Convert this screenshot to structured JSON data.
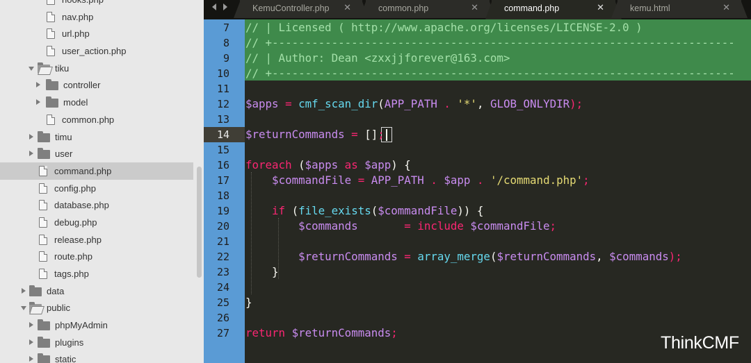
{
  "sidebar": {
    "items": [
      {
        "type": "file",
        "label": "hooks.php",
        "indent": 2
      },
      {
        "type": "file",
        "label": "nav.php",
        "indent": 2
      },
      {
        "type": "file",
        "label": "url.php",
        "indent": 2
      },
      {
        "type": "file",
        "label": "user_action.php",
        "indent": 2
      },
      {
        "type": "folder",
        "label": "tiku",
        "indent": 1,
        "open": true
      },
      {
        "type": "folder",
        "label": "controller",
        "indent": 2,
        "open": false
      },
      {
        "type": "folder",
        "label": "model",
        "indent": 2,
        "open": false
      },
      {
        "type": "file",
        "label": "common.php",
        "indent": 2
      },
      {
        "type": "folder",
        "label": "timu",
        "indent": 1,
        "open": false
      },
      {
        "type": "folder",
        "label": "user",
        "indent": 1,
        "open": false
      },
      {
        "type": "file",
        "label": "command.php",
        "indent": 1,
        "selected": true
      },
      {
        "type": "file",
        "label": "config.php",
        "indent": 1
      },
      {
        "type": "file",
        "label": "database.php",
        "indent": 1
      },
      {
        "type": "file",
        "label": "debug.php",
        "indent": 1
      },
      {
        "type": "file",
        "label": "release.php",
        "indent": 1
      },
      {
        "type": "file",
        "label": "route.php",
        "indent": 1
      },
      {
        "type": "file",
        "label": "tags.php",
        "indent": 1
      },
      {
        "type": "folder",
        "label": "data",
        "indent": 0,
        "open": false
      },
      {
        "type": "folder",
        "label": "public",
        "indent": 0,
        "open": true
      },
      {
        "type": "folder",
        "label": "phpMyAdmin",
        "indent": 1,
        "open": false
      },
      {
        "type": "folder",
        "label": "plugins",
        "indent": 1,
        "open": false
      },
      {
        "type": "folder",
        "label": "static",
        "indent": 1,
        "open": false
      }
    ]
  },
  "tabs": [
    {
      "label": "KemuController.php",
      "active": false
    },
    {
      "label": "common.php",
      "active": false
    },
    {
      "label": "command.php",
      "active": true
    },
    {
      "label": "kemu.html",
      "active": false
    }
  ],
  "tab_close_glyph": "✕",
  "editor": {
    "current_line": 14,
    "lines": [
      {
        "n": "7",
        "tokens": [
          {
            "t": "// | Licensed ( http://www.apache.org/licenses/LICENSE-2.0 )",
            "c": "cm"
          }
        ]
      },
      {
        "n": "8",
        "tokens": [
          {
            "t": "// +----------------------------------------------------------------------",
            "c": "cm"
          }
        ]
      },
      {
        "n": "9",
        "tokens": [
          {
            "t": "// | Author: Dean <zxxjjforever@163.com>",
            "c": "cm"
          }
        ]
      },
      {
        "n": "10",
        "tokens": [
          {
            "t": "// +----------------------------------------------------------------------",
            "c": "cm"
          }
        ]
      },
      {
        "n": "11",
        "tokens": []
      },
      {
        "n": "12",
        "tokens": [
          {
            "t": "$",
            "c": "pu"
          },
          {
            "t": "apps",
            "c": "var"
          },
          {
            "t": " = ",
            "c": "op"
          },
          {
            "t": "cmf_scan_dir",
            "c": "fn"
          },
          {
            "t": "(",
            "c": "pl"
          },
          {
            "t": "APP_PATH",
            "c": "co"
          },
          {
            "t": " . ",
            "c": "op"
          },
          {
            "t": "'*'",
            "c": "st"
          },
          {
            "t": ", ",
            "c": "pl"
          },
          {
            "t": "GLOB_ONLYDIR",
            "c": "co"
          },
          {
            "t": ");",
            "c": "op"
          }
        ]
      },
      {
        "n": "13",
        "tokens": []
      },
      {
        "n": "14",
        "tokens": [
          {
            "t": "$",
            "c": "pu"
          },
          {
            "t": "returnCommands",
            "c": "var"
          },
          {
            "t": " = ",
            "c": "op"
          },
          {
            "t": "[]",
            "c": "pl"
          },
          {
            "t": ";",
            "c": "op"
          }
        ]
      },
      {
        "n": "15",
        "tokens": []
      },
      {
        "n": "16",
        "tokens": [
          {
            "t": "foreach",
            "c": "kw"
          },
          {
            "t": " (",
            "c": "pl"
          },
          {
            "t": "$",
            "c": "pu"
          },
          {
            "t": "apps",
            "c": "var"
          },
          {
            "t": " as ",
            "c": "kw"
          },
          {
            "t": "$",
            "c": "pu"
          },
          {
            "t": "app",
            "c": "var"
          },
          {
            "t": ") {",
            "c": "pl"
          }
        ]
      },
      {
        "n": "17",
        "tokens": [
          {
            "t": "    ",
            "c": "pl"
          },
          {
            "t": "$",
            "c": "pu"
          },
          {
            "t": "commandFile",
            "c": "var"
          },
          {
            "t": " = ",
            "c": "op"
          },
          {
            "t": "APP_PATH",
            "c": "co"
          },
          {
            "t": " . ",
            "c": "op"
          },
          {
            "t": "$",
            "c": "pu"
          },
          {
            "t": "app",
            "c": "var"
          },
          {
            "t": " . ",
            "c": "op"
          },
          {
            "t": "'/command.php'",
            "c": "st"
          },
          {
            "t": ";",
            "c": "op"
          }
        ]
      },
      {
        "n": "18",
        "tokens": []
      },
      {
        "n": "19",
        "tokens": [
          {
            "t": "    ",
            "c": "pl"
          },
          {
            "t": "if",
            "c": "kw"
          },
          {
            "t": " (",
            "c": "pl"
          },
          {
            "t": "file_exists",
            "c": "fn"
          },
          {
            "t": "(",
            "c": "pl"
          },
          {
            "t": "$",
            "c": "pu"
          },
          {
            "t": "commandFile",
            "c": "var"
          },
          {
            "t": ")) {",
            "c": "pl"
          }
        ]
      },
      {
        "n": "20",
        "tokens": [
          {
            "t": "        ",
            "c": "pl"
          },
          {
            "t": "$",
            "c": "pu"
          },
          {
            "t": "commands",
            "c": "var"
          },
          {
            "t": "       = ",
            "c": "op"
          },
          {
            "t": "include",
            "c": "kw"
          },
          {
            "t": " ",
            "c": "pl"
          },
          {
            "t": "$",
            "c": "pu"
          },
          {
            "t": "commandFile",
            "c": "var"
          },
          {
            "t": ";",
            "c": "op"
          }
        ]
      },
      {
        "n": "21",
        "tokens": []
      },
      {
        "n": "22",
        "tokens": [
          {
            "t": "        ",
            "c": "pl"
          },
          {
            "t": "$",
            "c": "pu"
          },
          {
            "t": "returnCommands",
            "c": "var"
          },
          {
            "t": " = ",
            "c": "op"
          },
          {
            "t": "array_merge",
            "c": "fn"
          },
          {
            "t": "(",
            "c": "pl"
          },
          {
            "t": "$",
            "c": "pu"
          },
          {
            "t": "returnCommands",
            "c": "var"
          },
          {
            "t": ", ",
            "c": "pl"
          },
          {
            "t": "$",
            "c": "pu"
          },
          {
            "t": "commands",
            "c": "var"
          },
          {
            "t": ");",
            "c": "op"
          }
        ]
      },
      {
        "n": "23",
        "tokens": [
          {
            "t": "    }",
            "c": "pl"
          }
        ]
      },
      {
        "n": "24",
        "tokens": []
      },
      {
        "n": "25",
        "tokens": [
          {
            "t": "}",
            "c": "pl"
          }
        ]
      },
      {
        "n": "26",
        "tokens": []
      },
      {
        "n": "27",
        "tokens": [
          {
            "t": "return",
            "c": "kw"
          },
          {
            "t": " ",
            "c": "pl"
          },
          {
            "t": "$",
            "c": "pu"
          },
          {
            "t": "returnCommands",
            "c": "var"
          },
          {
            "t": ";",
            "c": "op"
          }
        ]
      }
    ]
  },
  "colors": {
    "cm": "#a3e0a8",
    "pu": "#c98cf0",
    "var": "#c98cf0",
    "op": "#f92672",
    "fn": "#66d9ef",
    "pl": "#f8f8f2",
    "co": "#c98cf0",
    "st": "#e6db74",
    "kw": "#f92672",
    "gutter_bg": "#5a9bd5",
    "comment_band": "#3f8a4b"
  },
  "watermark": "ThinkCMF"
}
